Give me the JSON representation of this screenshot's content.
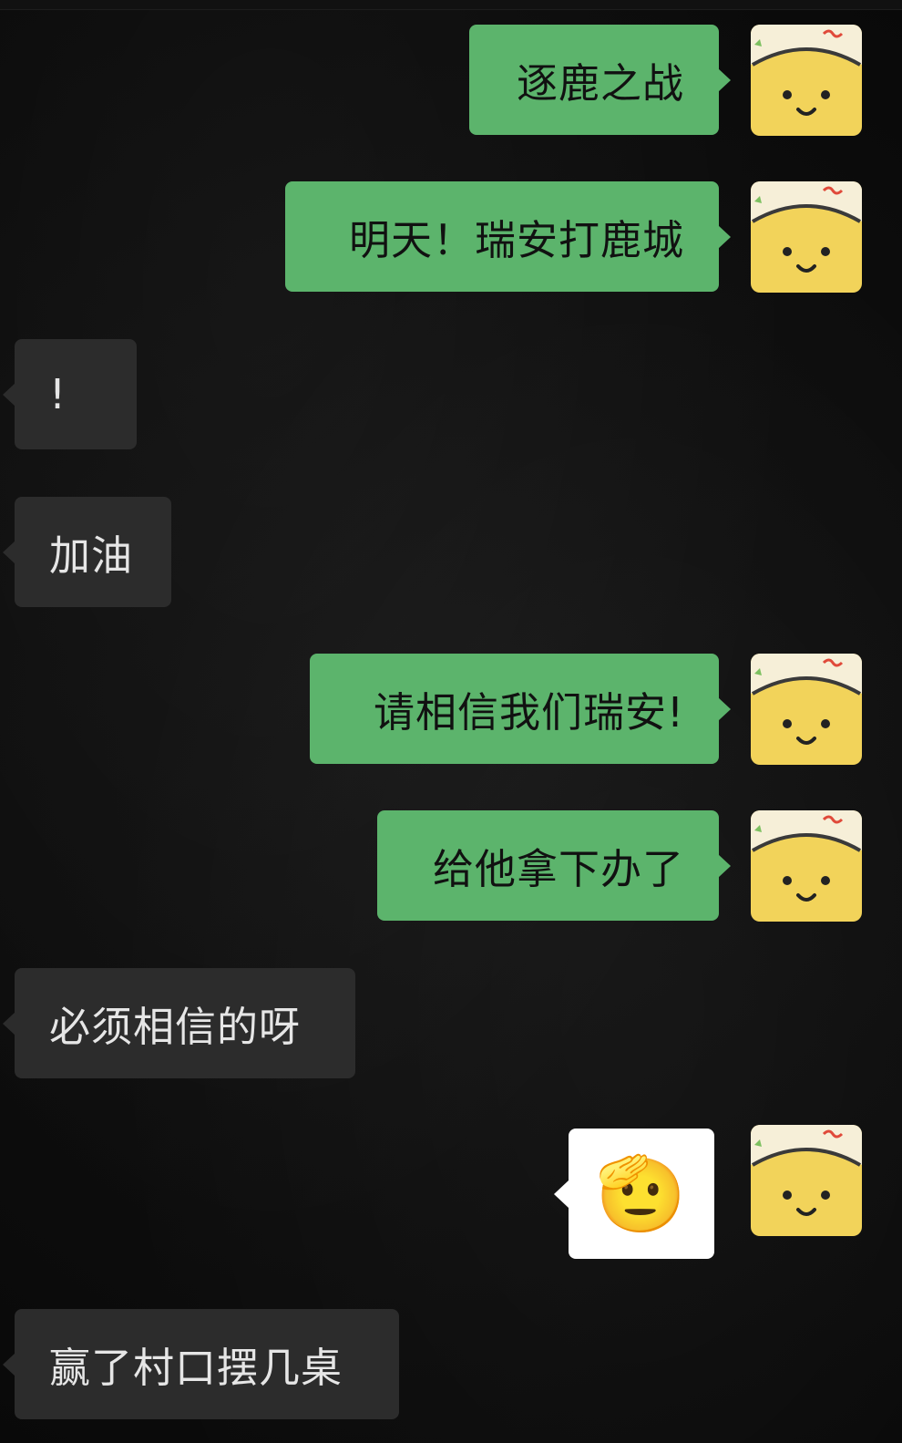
{
  "messages": [
    {
      "side": "out",
      "text": "逐鹿之战"
    },
    {
      "side": "out",
      "text": "明天！瑞安打鹿城"
    },
    {
      "side": "in",
      "text": "!"
    },
    {
      "side": "in",
      "text": "加油"
    },
    {
      "side": "out",
      "text": "请相信我们瑞安!"
    },
    {
      "side": "out",
      "text": "给他拿下办了"
    },
    {
      "side": "in",
      "text": "必须相信的呀"
    },
    {
      "side": "out",
      "sticker": "🫡"
    },
    {
      "side": "in",
      "text": "赢了村口摆几桌"
    }
  ],
  "colors": {
    "outgoing_bubble": "#5cb46c",
    "incoming_bubble": "#2c2c2c",
    "background": "#0c0c0c",
    "avatar": "#f2d35a"
  },
  "avatar_icon": "yellow-smiley-face-icon"
}
